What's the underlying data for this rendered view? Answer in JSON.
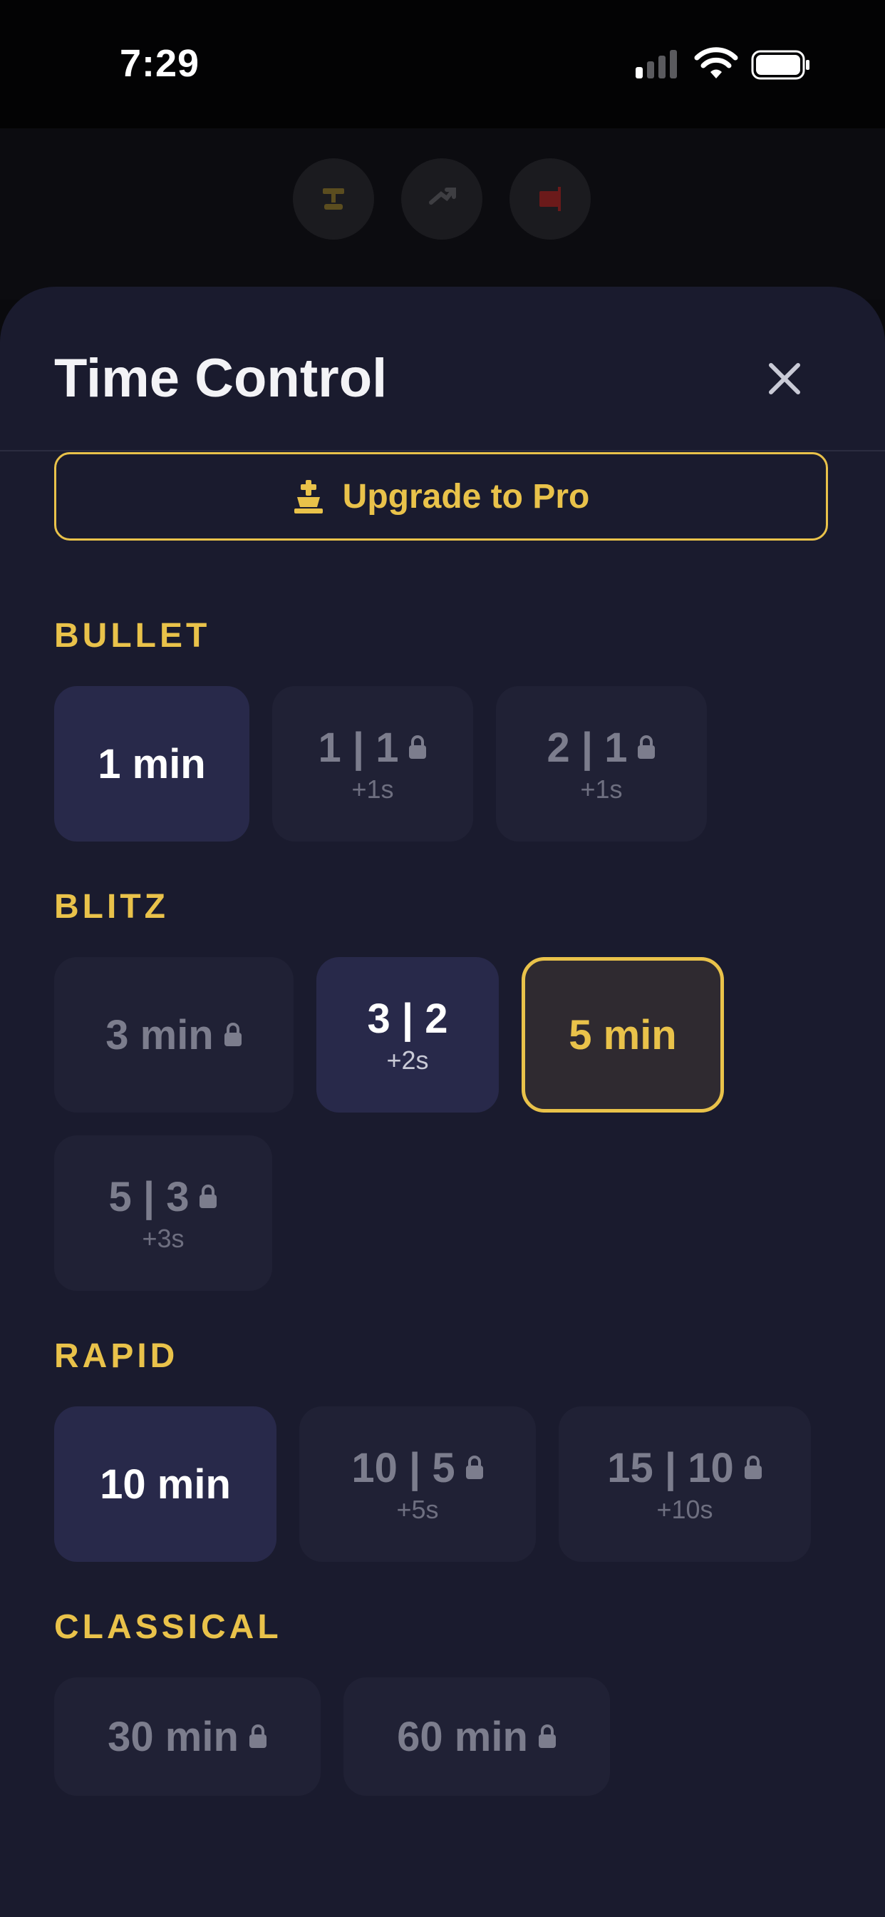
{
  "status_bar": {
    "time": "7:29"
  },
  "sheet": {
    "title": "Time Control",
    "upgrade_label": "Upgrade to Pro"
  },
  "sections": {
    "bullet": {
      "title": "BULLET",
      "options": [
        {
          "label": "1 min",
          "increment": "",
          "locked": false
        },
        {
          "label": "1 | 1",
          "increment": "+1s",
          "locked": true
        },
        {
          "label": "2 | 1",
          "increment": "+1s",
          "locked": true
        }
      ]
    },
    "blitz": {
      "title": "BLITZ",
      "options": [
        {
          "label": "3 min",
          "increment": "",
          "locked": true
        },
        {
          "label": "3 | 2",
          "increment": "+2s",
          "locked": false
        },
        {
          "label": "5 min",
          "increment": "",
          "locked": false,
          "selected": true
        },
        {
          "label": "5 | 3",
          "increment": "+3s",
          "locked": true
        }
      ]
    },
    "rapid": {
      "title": "RAPID",
      "options": [
        {
          "label": "10 min",
          "increment": "",
          "locked": false
        },
        {
          "label": "10 | 5",
          "increment": "+5s",
          "locked": true
        },
        {
          "label": "15 | 10",
          "increment": "+10s",
          "locked": true
        }
      ]
    },
    "classical": {
      "title": "CLASSICAL",
      "options": [
        {
          "label": "30 min",
          "increment": "",
          "locked": true
        },
        {
          "label": "60 min",
          "increment": "",
          "locked": true
        }
      ]
    }
  },
  "colors": {
    "accent": "#e9c24a",
    "sheet_bg": "#1a1b2e",
    "chip_bg": "#202135",
    "chip_active_bg": "#28294a"
  },
  "icons": [
    "signal-icon",
    "wifi-icon",
    "battery-icon",
    "crown-icon",
    "swap-icon",
    "flag-icon",
    "close-icon",
    "lock-icon"
  ]
}
